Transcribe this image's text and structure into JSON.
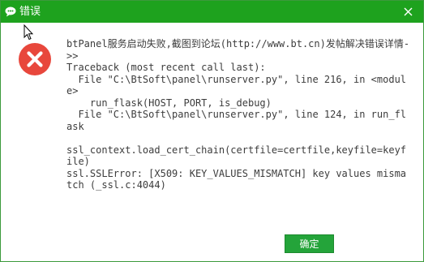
{
  "window": {
    "title": "错误",
    "accent_color": "#1ea21e"
  },
  "icons": {
    "app_icon": "chat-bubble-icon",
    "close_icon": "close-icon",
    "error_icon": "error-circle-x-icon",
    "cursor": "mouse-cursor-icon"
  },
  "message": {
    "text": "btPanel服务启动失败,截图到论坛(http://www.bt.cn)发帖解决错误详情->>\nTraceback (most recent call last):\n  File \"C:\\BtSoft\\panel\\runserver.py\", line 216, in <module>\n    run_flask(HOST, PORT, is_debug)\n  File \"C:\\BtSoft\\panel\\runserver.py\", line 124, in run_flask\n\nssl_context.load_cert_chain(certfile=certfile,keyfile=keyfile)\nssl.SSLError: [X509: KEY_VALUES_MISMATCH] key values mismatch (_ssl.c:4044)"
  },
  "buttons": {
    "ok_label": "确定"
  }
}
